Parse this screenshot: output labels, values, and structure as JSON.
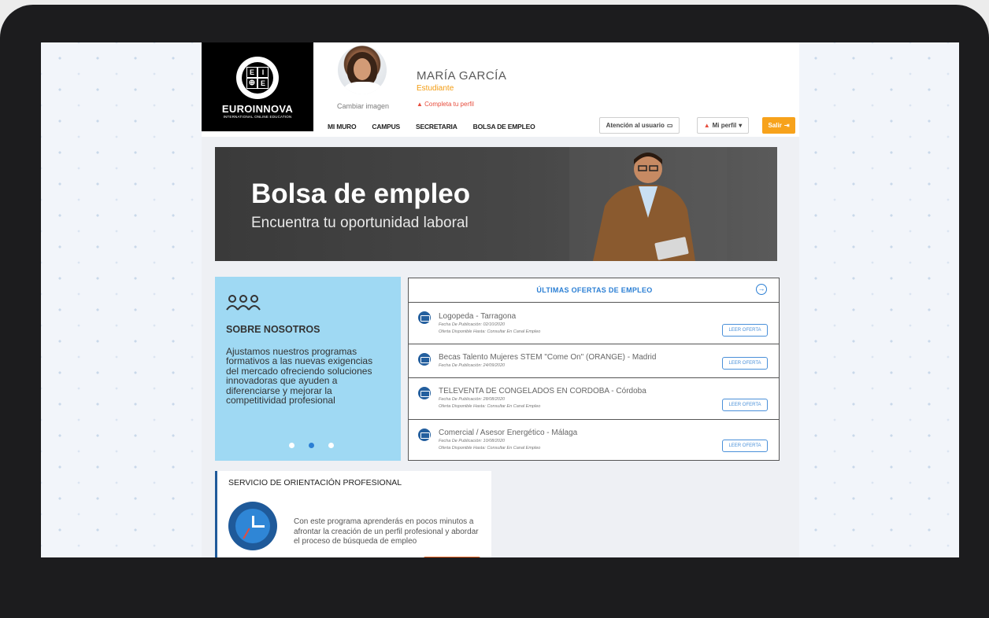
{
  "colors": {
    "accent_blue": "#2b7fd4",
    "orange": "#f7a21b",
    "warning_red": "#e74c3c",
    "about_bg": "#9fd9f3"
  },
  "brand": {
    "logo_letters": [
      "E",
      "I",
      "E",
      "E"
    ],
    "name": "EUROINNOVA",
    "tagline": "INTERNATIONAL ONLINE EDUCATION"
  },
  "user": {
    "change_image": "Cambiar imagen",
    "name": "MARÍA GARCÍA",
    "role": "Estudiante",
    "complete_profile": "Completa tu perfil"
  },
  "nav": [
    "MI MURO",
    "CAMPUS",
    "SECRETARIA",
    "BOLSA DE EMPLEO"
  ],
  "actions": {
    "support": "Atención al usuario",
    "profile": "Mi perfil",
    "logout": "Salir"
  },
  "hero": {
    "title": "Bolsa de empleo",
    "subtitle": "Encuentra tu oportunidad laboral"
  },
  "about": {
    "title": "SOBRE NOSOTROS",
    "text": "Ajustamos nuestros programas formativos a las nuevas exigencias del mercado ofreciendo soluciones innovadoras que ayuden a diferenciarse y mejorar la competitividad profesional",
    "carousel_active_index": 1
  },
  "offers": {
    "heading": "ÚLTIMAS OFERTAS DE EMPLEO",
    "button_label": "LEER OFERTA",
    "items": [
      {
        "title": "Logopeda - Tarragona",
        "published": "Fecha De Publicación: 02/10/2020",
        "available": "Oferta Disponible Hasta: Consultar En Canal Empleo"
      },
      {
        "title": "Becas Talento Mujeres STEM \"Come On\" (ORANGE) - Madrid",
        "published": "Fecha De Publicación: 24/09/2020",
        "available": ""
      },
      {
        "title": "TELEVENTA DE CONGELADOS EN CORDOBA - Córdoba",
        "published": "Fecha De Publicación: 28/08/2020",
        "available": "Oferta Disponible Hasta: Consultar En Canal Empleo"
      },
      {
        "title": "Comercial / Asesor Energético - Málaga",
        "published": "Fecha De Publicación: 10/08/2020",
        "available": "Oferta Disponible Hasta: Consultar En Canal Empleo"
      }
    ]
  },
  "orientation": {
    "title": "SERVICIO DE ORIENTACIÓN PROFESIONAL",
    "text": "Con este programa aprenderás en pocos minutos a afrontar la creación de un perfil profesional y abordar el proceso de búsqueda de empleo"
  }
}
